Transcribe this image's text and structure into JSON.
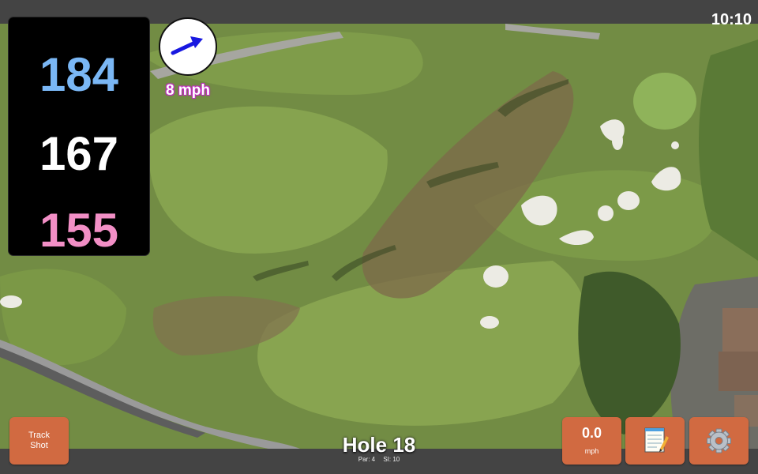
{
  "status": {
    "time": "10:10"
  },
  "distances": {
    "back": "184",
    "center": "167",
    "front": "155"
  },
  "wind": {
    "speed": "8 mph",
    "icon": "wind-arrow-icon"
  },
  "hole": {
    "title": "Hole 18",
    "par_label": "Par: 4",
    "si_label": "SI: 10"
  },
  "buttons": {
    "track_line1": "Track",
    "track_line2": "Shot",
    "speed_value": "0.0",
    "speed_unit": "mph",
    "notes_icon": "notepad-icon",
    "settings_icon": "gear-icon"
  },
  "colors": {
    "back": "#7ab7f5",
    "center": "#ffffff",
    "front": "#f28fc6",
    "button": "#d16a41",
    "wind_arrow": "#1818e0"
  }
}
